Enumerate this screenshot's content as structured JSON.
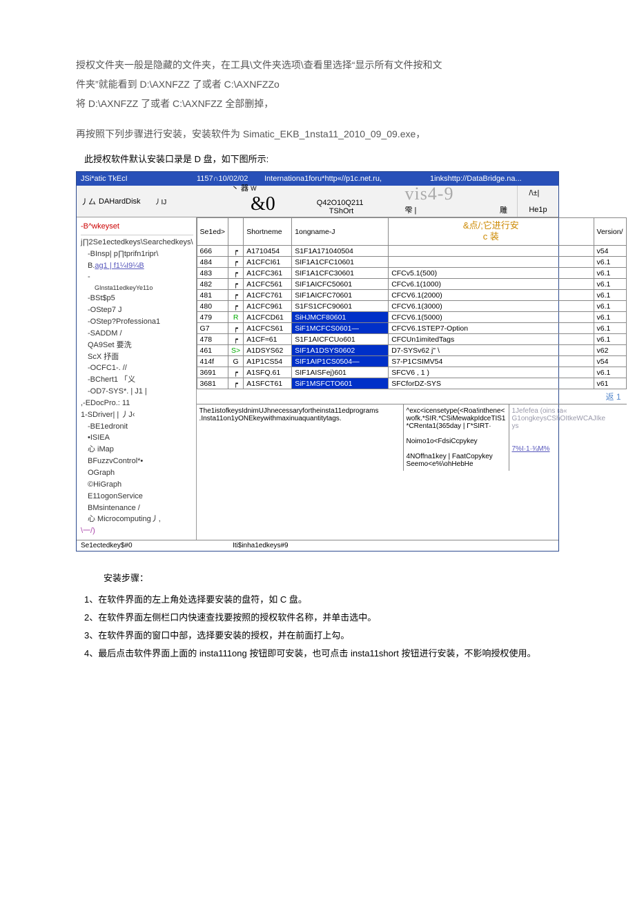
{
  "intro": {
    "p1": "授权文件夹一般是隐藏的文件夹，在工具\\文件夹选项\\查看里选择“显示所有文件按和文",
    "p2": "件夹”就能看到 D:\\AXNFZZ 了或者 C:\\AXNFZZo",
    "p3": "将 D:\\AXNFZZ 了或者 C:\\AXNFZZ 全部删掉，",
    "p4": "再按照下列步骤进行安装，安装软件为 Simatic_EKB_1nsta11_2010_09_09.exe，",
    "p5": "此授权软件默认安装口录是 D 盘，如下图所示:"
  },
  "titlebar": {
    "left": "JSi*atic            TkEcI",
    "date": "1157∩10/02/02",
    "mid": "Internationa1foru*http«//p1c.net.ru,",
    "right": "1inkshttp://DataBridge.na..."
  },
  "toolbar": {
    "disk_icon": "丿厶",
    "disk_label": "DAHardDisk",
    "sub": "丿IJ",
    "sub2": "|<",
    "big_ab": "丶 器",
    "big_amp": "&0",
    "w": "W",
    "q": "Q42O10Q211",
    "tshort": "TShOrt",
    "vis": "vis4-9",
    "ext": "雫 |",
    "carve": "雕",
    "incr": "/\\±|",
    "help": "He1p"
  },
  "banner": {
    "l1": "&点/;它进行安",
    "l2": "c 装"
  },
  "headers": {
    "seled": "Se1ed>",
    "shortname": "Shortneme",
    "longname": "1ongname-J",
    "desc": "",
    "version": "Version/"
  },
  "rows": [
    {
      "sel": "666",
      "chk": "",
      "sh": "A1710454",
      "ln": "S1F1A171040504",
      "desc": "",
      "ver": "v54",
      "hl": false
    },
    {
      "sel": "484",
      "chk": "",
      "sh": "A1CFCI61",
      "ln": "SIF1A1CFC10601",
      "desc": "",
      "ver": "v6.1",
      "hl": false
    },
    {
      "sel": "483",
      "chk": "",
      "sh": "A1CFC361",
      "ln": "SIF1A1CFC30601",
      "desc": "CFCv5.1(500)",
      "ver": "v6.1",
      "hl": false
    },
    {
      "sel": "482",
      "chk": "",
      "sh": "A1CFC561",
      "ln": "SIF1AICFC50601",
      "desc": "CFCv6.1(1000)",
      "ver": "v6.1",
      "hl": false
    },
    {
      "sel": "481",
      "chk": "",
      "sh": "A1CFC761",
      "ln": "SIF1AICFC70601",
      "desc": "CFCV6.1(2000)",
      "ver": "v6.1",
      "hl": false
    },
    {
      "sel": "480",
      "chk": "",
      "sh": "A1CFC961",
      "ln": "S1FS1CFC90601",
      "desc": "CFCV6.1(3000)",
      "ver": "v6.1",
      "hl": false
    },
    {
      "sel": "479",
      "chk": "R",
      "sh": "A1CFCD61",
      "ln": "SiHJMCF80601",
      "desc": "CFCV6.1(5000)",
      "ver": "v6.1",
      "hl": true,
      "g": true
    },
    {
      "sel": "G7",
      "chk": "",
      "sh": "A1CFCS61",
      "ln": "SiF1MCFCS0601—",
      "desc": "CFCV6.1STEP7-Option",
      "ver": "v6.1",
      "hl": true
    },
    {
      "sel": "478",
      "chk": "",
      "sh": "A1CF≈61",
      "ln": "S1F1AICFCUo601",
      "desc": "CFCUn1imitedTags",
      "ver": "v6.1",
      "hl": false
    },
    {
      "sel": "461",
      "chk": "S>",
      "sh": "A1DSYS62",
      "ln": "SIF1A1DSYS0602",
      "desc": "D7-SYSv62          j\"                    \\",
      "ver": "v62",
      "hl": true,
      "g": true
    },
    {
      "sel": "414f",
      "chk": "G",
      "sh": "A1P1CS54",
      "ln": "SIF1AIP1CS0504—",
      "desc": "S7-P1CSIMV54",
      "ver": "v54",
      "hl": true
    },
    {
      "sel": "3691",
      "chk": "",
      "sh": "A1SFQ.61",
      "ln": "SIF1AISFej)601",
      "desc": "SFCV6                       , 1       )",
      "ver": "v6.1",
      "hl": false
    },
    {
      "sel": "3681",
      "chk": "",
      "sh": "A1SFCT61",
      "ln": "SiF1MSFCTO601",
      "desc": "SFCforDZ-SYS",
      "ver": "v61",
      "hl": true
    }
  ],
  "sidebar": {
    "h1": "-B^wkeyset",
    "grp": "j∏2Se1ectedkeys\\Searchedkeys\\",
    "i1": "-BInsp| p∏tprifn1ripr\\",
    "i2": "B",
    "i2link": "ag1 | f1¼I9¼B",
    "i3": "GInsta11edkeyYe11o",
    "i4": "-BSt$p5",
    "i5": "-OStep7                   J",
    "i6": "-OStep?Professiona1",
    "i7": "-SADDM              /",
    "i8": "QA9Set 要洗",
    "i9": "ScX 抒面",
    "i10": "-OCFC1-. //",
    "i11": "-BChert1 「义",
    "i12": "-OD7-SYS*. | J1 |",
    "grp2": ",-EDocPro.: 11",
    "grp3": "1-SDriver| | 丿J‹",
    "i13": "-BE1edronit",
    "i14": "•ISIEA",
    "i15": "心 iMap",
    "i16": "BFuzzvControl*•",
    "i17": "OGraph",
    "i18": "©HiGraph",
    "i19": "E11ogonService",
    "i20": "BMsintenance           /",
    "i21": "心 Microcomputing丿,",
    "end": "\\一/)",
    "bl": "Se1ectedkey$#0",
    "bl2": "Iti$inha1edkeys#9"
  },
  "bottom": {
    "l1": "The1istofkeysIdnimUJhnecessaryfortheinsta11edprograms",
    "l2": ".Insta11on1yONEkeywithmaxinuaquantitytags.",
    "m1": "^exc<icensetype(<Roa!inthene<",
    "m2": "wofk.*SIR.*CSiMewakpIdceTIS1",
    "m3": "*CRenta1(365day | Γ*SIRT·",
    "m4": "Noimo1o<FdsiCcpykey",
    "m5": "4NOffna1key   | FaatCopykey",
    "m6": "Seemo<e%\\ohHebHe",
    "r1": "1Jefefea (oins (a«",
    "r2": "G1ongkeysCShOItkeWCAJIke",
    "r3": "ys",
    "r4": "7%I·1·¾M%"
  },
  "back": "返 1",
  "instr": {
    "h": "安装步骤：",
    "s1": "1、在软件界面的左上角处选择要安装的盘符，如 C 盘。",
    "s2": "2、在软件界面左侧栏口内快速查找要按照的授权软件名称，并单击选中。",
    "s3": "3、在软件界面的窗口中部，选择要安装的授权，并在前面打上勾。",
    "s4": "4、最后点击软件界面上面的 insta111ong 按钮即可安装，也可点击 insta11short 按钮进行安装，不影响授权使用。"
  }
}
